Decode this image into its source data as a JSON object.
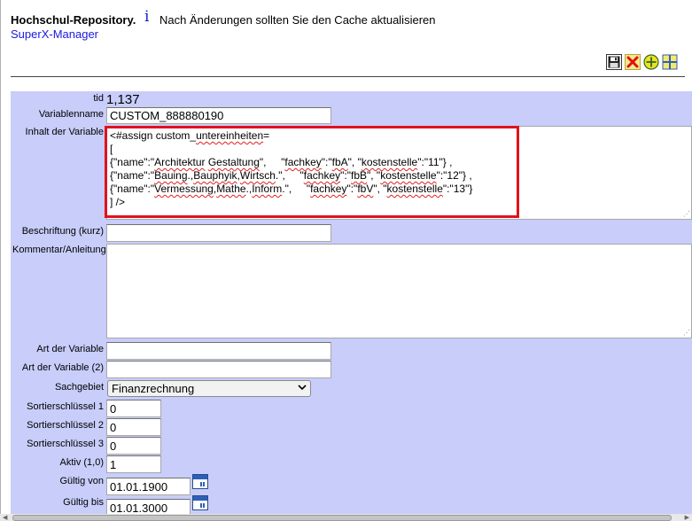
{
  "header": {
    "title": "Hochschul-Repository.",
    "info_icon": "i",
    "notice": "Nach Änderungen sollten Sie den Cache aktualisieren",
    "app_link": "SuperX-Manager"
  },
  "toolbar": {
    "icons": [
      "save-icon",
      "delete-icon",
      "add-icon",
      "grid-icon"
    ]
  },
  "form": {
    "tid_label": "tid",
    "tid_value": "1,137",
    "varname_label": "Variablenname",
    "varname_value": "CUSTOM_888880190",
    "content_label": "Inhalt der Variable",
    "content_lines": [
      "<#assign custom_untereinheiten=",
      "[",
      "{\"name\":\"Architektur Gestaltung\",     \"fachkey\":\"fbA\", \"kostenstelle\":\"11\"} ,",
      "{\"name\":\"Bauing.,Bauphyik,Wirtsch.\",     \"fachkey\":\"fbB\", \"kostenstelle\":\"12\"} ,",
      "{\"name\":\"Vermessung,Mathe.,Inform.\",     \"fachkey\":\"fbV\", \"kostenstelle\":\"13\"}",
      "] />"
    ],
    "caption_label": "Beschriftung (kurz)",
    "caption_value": "",
    "comment_label": "Kommentar/Anleitung",
    "comment_value": "",
    "type_label": "Art der Variable",
    "type_value": "",
    "type2_label": "Art der Variable (2)",
    "type2_value": "",
    "area_label": "Sachgebiet",
    "area_value": "Finanzrechnung",
    "sort1_label": "Sortierschlüssel 1",
    "sort1_value": "0",
    "sort2_label": "Sortierschlüssel 2",
    "sort2_value": "0",
    "sort3_label": "Sortierschlüssel 3",
    "sort3_value": "0",
    "active_label": "Aktiv (1,0)",
    "active_value": "1",
    "valid_from_label": "Gültig von",
    "valid_from_value": "01.01.1900",
    "valid_to_label": "Gültig bis",
    "valid_to_value": "01.01.3000"
  },
  "colors": {
    "panel_bg": "#c8cdfa",
    "highlight_border": "#e0121c",
    "link": "#1a1adc"
  }
}
